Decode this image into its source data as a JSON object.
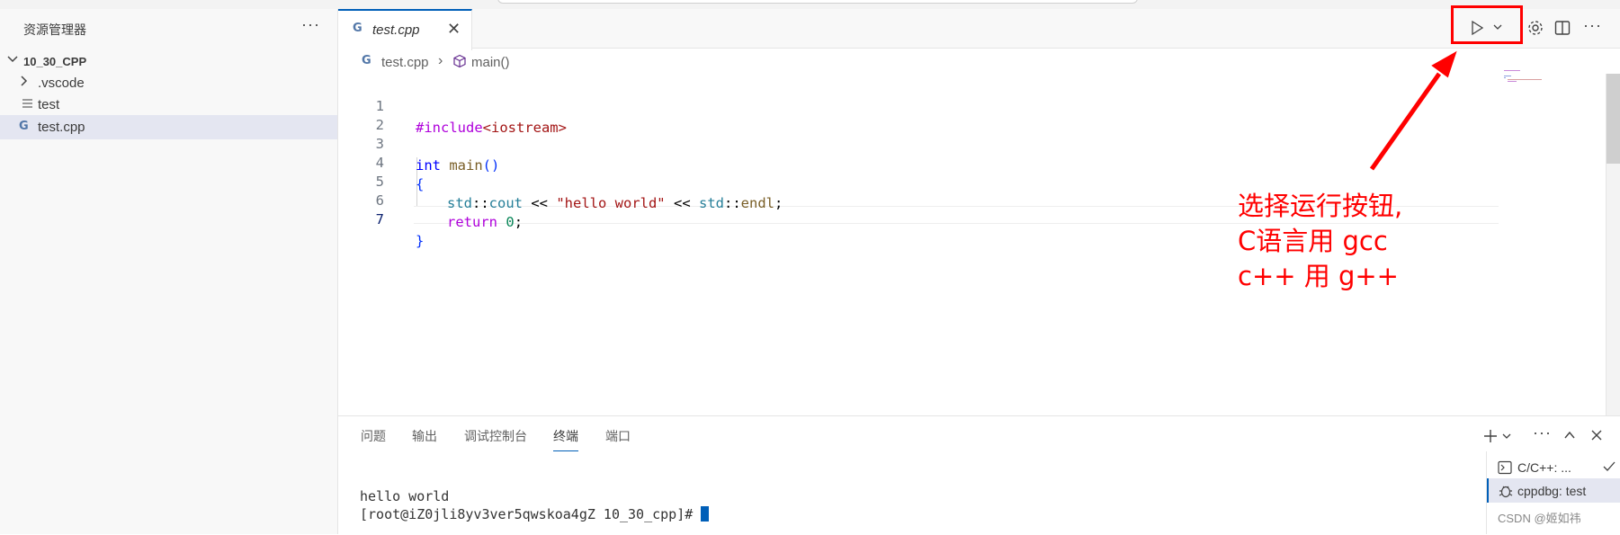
{
  "sidebar": {
    "title": "资源管理器",
    "more": "···",
    "folder": "10_30_CPP",
    "items": [
      {
        "label": ".vscode",
        "icon": "chevron-right-icon"
      },
      {
        "label": "test",
        "icon": "file-lines-icon"
      },
      {
        "label": "test.cpp",
        "icon": "cpp-file-icon"
      }
    ]
  },
  "editor": {
    "tab_label": "test.cpp",
    "breadcrumb": [
      "test.cpp",
      "main()"
    ],
    "lines": [
      {
        "n": "1"
      },
      {
        "n": "2"
      },
      {
        "n": "3"
      },
      {
        "n": "4"
      },
      {
        "n": "5"
      },
      {
        "n": "6"
      },
      {
        "n": "7"
      }
    ],
    "code": {
      "l1_a": "#include",
      "l1_b": "<iostream>",
      "l3_kw": "int",
      "l3_fn": "main",
      "l3_paren": "()",
      "l4": "{",
      "l5_ns1": "std",
      "l5_sep1": "::",
      "l5_var": "cout",
      "l5_op1": " << ",
      "l5_str": "\"hello world\"",
      "l5_op2": " << ",
      "l5_ns2": "std",
      "l5_sep2": "::",
      "l5_fn": "endl",
      "l5_end": ";",
      "l6_kw": "return",
      "l6_num": "0",
      "l6_end": ";",
      "l7": "}"
    }
  },
  "annotation": {
    "line1": "选择运行按钮,",
    "line2": "C语言用 gcc",
    "line3": "c++ 用 g++"
  },
  "panel": {
    "tabs": [
      "问题",
      "输出",
      "调试控制台",
      "终端",
      "端口"
    ],
    "active_tab": "终端",
    "terminal_lines": [
      "hello world",
      "[root@iZ0jli8yv3ver5qwskoa4gZ 10_30_cpp]# "
    ],
    "terminals": [
      "C/C++: ...",
      "cppdbg: test"
    ]
  },
  "watermark": "CSDN @姬如祎",
  "colors": {
    "accent": "#005fb8",
    "annotation": "#ff0000"
  }
}
